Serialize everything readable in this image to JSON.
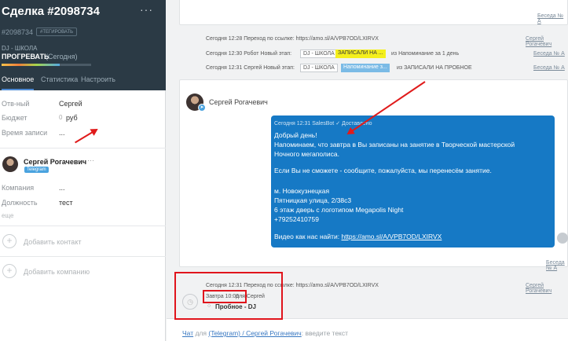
{
  "deal": {
    "title": "Сделка #2098734",
    "number": "#2098734",
    "tag_button": "#ТЕГИРОВАТЬ",
    "pipeline": "DJ - ШКОЛА",
    "stage": "ПРОГРЕВАТЬ",
    "stage_time": "(Сегодня)",
    "menu": "···"
  },
  "tabs": [
    "Основное",
    "Статистика",
    "Настроить"
  ],
  "fields": {
    "responsible_label": "Отв-ный",
    "responsible_value": "Сергей",
    "budget_label": "Бюджет",
    "budget_value": "0",
    "budget_currency": "руб",
    "record_time_label": "Время записи",
    "record_time_value": "..."
  },
  "contact": {
    "name": "Сергей Рогачевич",
    "badge": "Telegram",
    "dots": "···",
    "company_label": "Компания",
    "company_value": "...",
    "position_label": "Должность",
    "position_value": "тест",
    "more": "еще"
  },
  "actions": {
    "add_contact": "Добавить контакт",
    "add_company": "Добавить компанию",
    "plus": "+"
  },
  "feed": {
    "top_link": "Беседа № А",
    "events": [
      {
        "text": "Сегодня 12:28 Переход по ссылке: https://amo.sl/A/VPB7OD/LXIRVX",
        "link": "Сергей Рогачевич"
      },
      {
        "prefix": "Сегодня 12:30 Робот  Новый этап:",
        "from": "DJ - ШКОЛА",
        "to": "ЗАПИСАЛИ НА ...",
        "suffix": "из Напоминание за 1 день"
      },
      {
        "prefix": "Сегодня 12:31 Сергей  Новый этап:",
        "from": "DJ - ШКОЛА",
        "to": "Напоминание з...",
        "suffix": "из ЗАПИСАЛИ НА ПРОБНОЕ"
      }
    ],
    "event_links": [
      "Беседа № А",
      "Беседа № А"
    ],
    "message": {
      "author": "Сергей Рогачевич",
      "meta": "Сегодня 12:31 SalesBot  ✓ Доставлено",
      "lines": [
        "Добрый день!",
        "Напоминаем, что завтра в    Вы записаны на занятие в Творческой мастерской",
        "Ночного мегаполиса.",
        "",
        "Если Вы не сможете - сообщите, пожалуйста, мы перенесём занятие.",
        "",
        "м. Новокузнецкая",
        "Пятницкая улица, 2/38с3",
        "6 этаж дверь с логотипом Megapolis Night",
        "+79252410759",
        ""
      ],
      "video_prefix": "Видео как нас найти: ",
      "video_link": "https://amo.sl/A/VPB7OD/LXIRVX",
      "talk_link": "Беседа № А"
    },
    "after_event": {
      "text": "Сегодня 12:31 Переход по ссылке: https://amo.sl/A/VPB7OD/LXIRVX",
      "link": "Сергей Рогачевич"
    },
    "task": {
      "time": "Завтра 10:00",
      "for": "для Сергей",
      "title": "Пробное - DJ",
      "check": "○"
    },
    "composer": {
      "chat": "Чат",
      "for": " для ",
      "channel": "(Telegram) / Сергей Рогачевич",
      "hint": ": введите текст"
    }
  },
  "colors": {
    "accent": "#1679c5",
    "header": "#2b3a45",
    "annotation": "#e0141c"
  },
  "progress": {
    "stage_fraction": 0.65
  }
}
